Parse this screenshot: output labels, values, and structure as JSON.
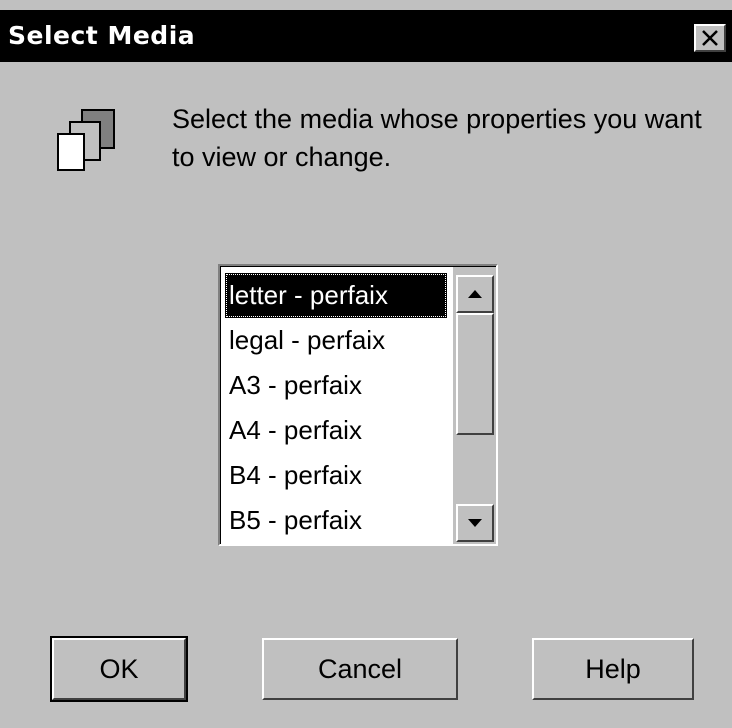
{
  "window": {
    "title": "Select Media",
    "close_icon": "close-icon"
  },
  "message": {
    "icon": "media-pages-icon",
    "text": "Select the media whose properties you want to view or change."
  },
  "media_list": {
    "selected_index": 0,
    "items": [
      {
        "label": "letter - perfaix"
      },
      {
        "label": "legal - perfaix"
      },
      {
        "label": "A3 - perfaix"
      },
      {
        "label": "A4 - perfaix"
      },
      {
        "label": "B4 - perfaix"
      },
      {
        "label": "B5 - perfaix"
      }
    ],
    "scroll_up_icon": "scroll-up-arrow-icon",
    "scroll_down_icon": "scroll-down-arrow-icon"
  },
  "buttons": {
    "ok_label": "OK",
    "cancel_label": "Cancel",
    "help_label": "Help"
  },
  "colors": {
    "dialog_bg": "#c0c0c0",
    "titlebar_bg": "#000000",
    "titlebar_text": "#ffffff",
    "selection_bg": "#000000",
    "selection_text": "#ffffff"
  }
}
